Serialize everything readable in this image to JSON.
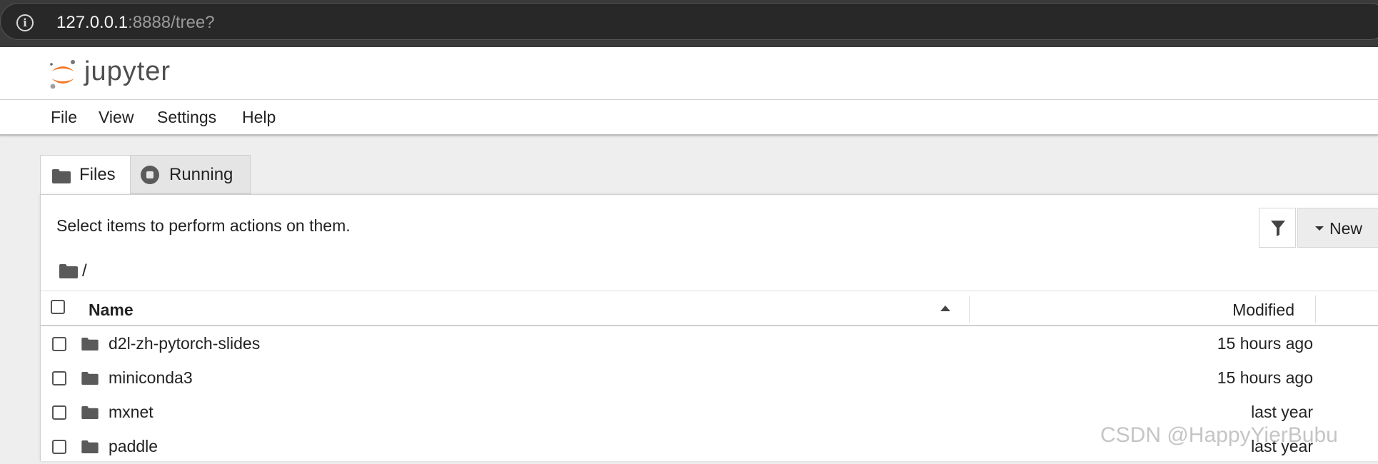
{
  "browser": {
    "url_host": "127.0.0.1",
    "url_path": ":8888/tree?"
  },
  "header": {
    "logo_text": "jupyter"
  },
  "menu": {
    "items": [
      "File",
      "View",
      "Settings",
      "Help"
    ]
  },
  "tabs": [
    {
      "label": "Files",
      "icon": "folder-icon",
      "active": true
    },
    {
      "label": "Running",
      "icon": "stop-circle-icon",
      "active": false
    }
  ],
  "toolbar": {
    "hint": "Select items to perform actions on them.",
    "new_label": "New",
    "filter_icon": "filter-icon"
  },
  "breadcrumb": {
    "path": "/"
  },
  "table": {
    "columns": {
      "name": "Name",
      "modified": "Modified"
    },
    "rows": [
      {
        "name": "d2l-zh-pytorch-slides",
        "modified": "15 hours ago"
      },
      {
        "name": "miniconda3",
        "modified": "15 hours ago"
      },
      {
        "name": "mxnet",
        "modified": "last year"
      },
      {
        "name": "paddle",
        "modified": "last year"
      }
    ]
  },
  "watermark": "CSDN @HappyYierBubu",
  "colors": {
    "jupyter_orange": "#f37626",
    "browser_bg": "#282828"
  }
}
